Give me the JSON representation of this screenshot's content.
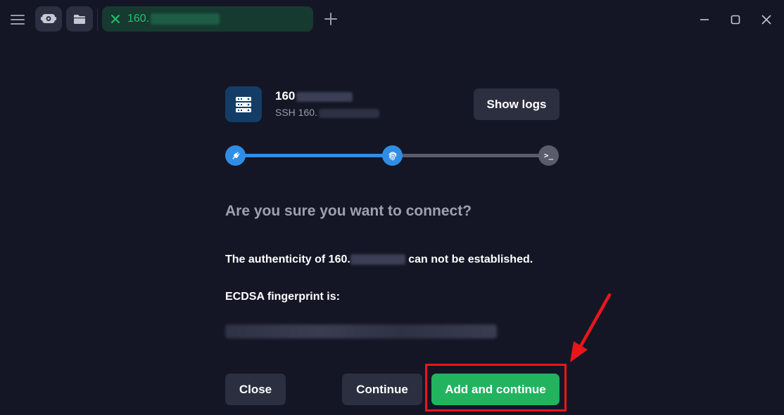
{
  "tab": {
    "label": "160."
  },
  "host": {
    "name": "160",
    "subtitle": "SSH 160."
  },
  "buttons": {
    "show_logs": "Show logs",
    "close": "Close",
    "continue": "Continue",
    "add_and_continue": "Add and continue"
  },
  "progress": {
    "steps": [
      "plug-icon",
      "fingerprint-icon",
      "terminal-icon"
    ],
    "current_step": 2,
    "step3_glyph": ">_"
  },
  "dialog": {
    "heading": "Are you sure you want to connect?",
    "authenticity_prefix": "The authenticity of 160.",
    "authenticity_suffix": " can not be established.",
    "fingerprint_label": "ECDSA fingerprint is:"
  },
  "colors": {
    "background": "#141625",
    "accent_blue": "#2f8de6",
    "accent_green": "#22b35f",
    "tab_text": "#23c26a",
    "annotation_red": "#e8161b"
  }
}
